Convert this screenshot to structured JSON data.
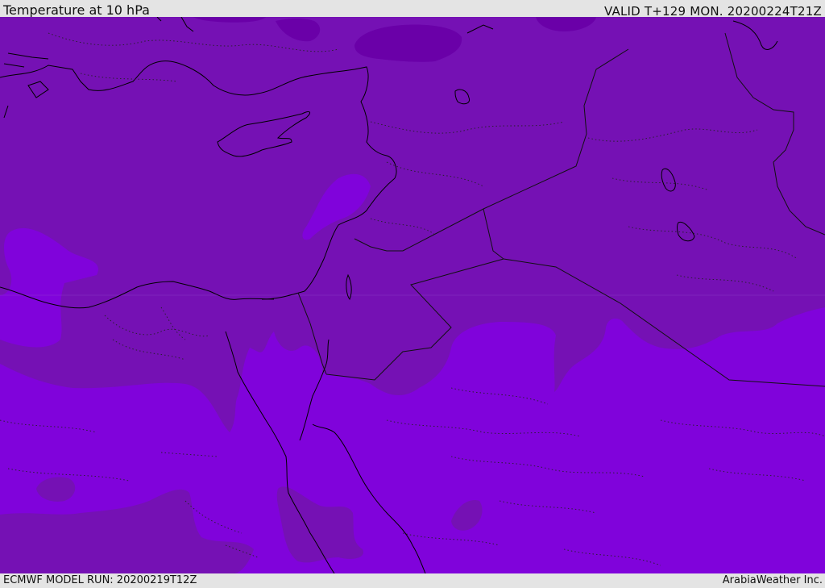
{
  "header": {
    "title": "Temperature at 10 hPa",
    "valid": "VALID T+129 MON. 20200224T21Z"
  },
  "footer": {
    "model_run": "ECMWF MODEL RUN: 20200219T12Z",
    "credit": "ArabiaWeather Inc."
  },
  "map": {
    "region": "Eastern Mediterranean / Middle East",
    "colors": {
      "dark_fill": "#7511b4",
      "mid_fill": "#8003db",
      "deep_patch": "#6a00a8",
      "coastline": "#000000",
      "border": "#111111"
    }
  }
}
